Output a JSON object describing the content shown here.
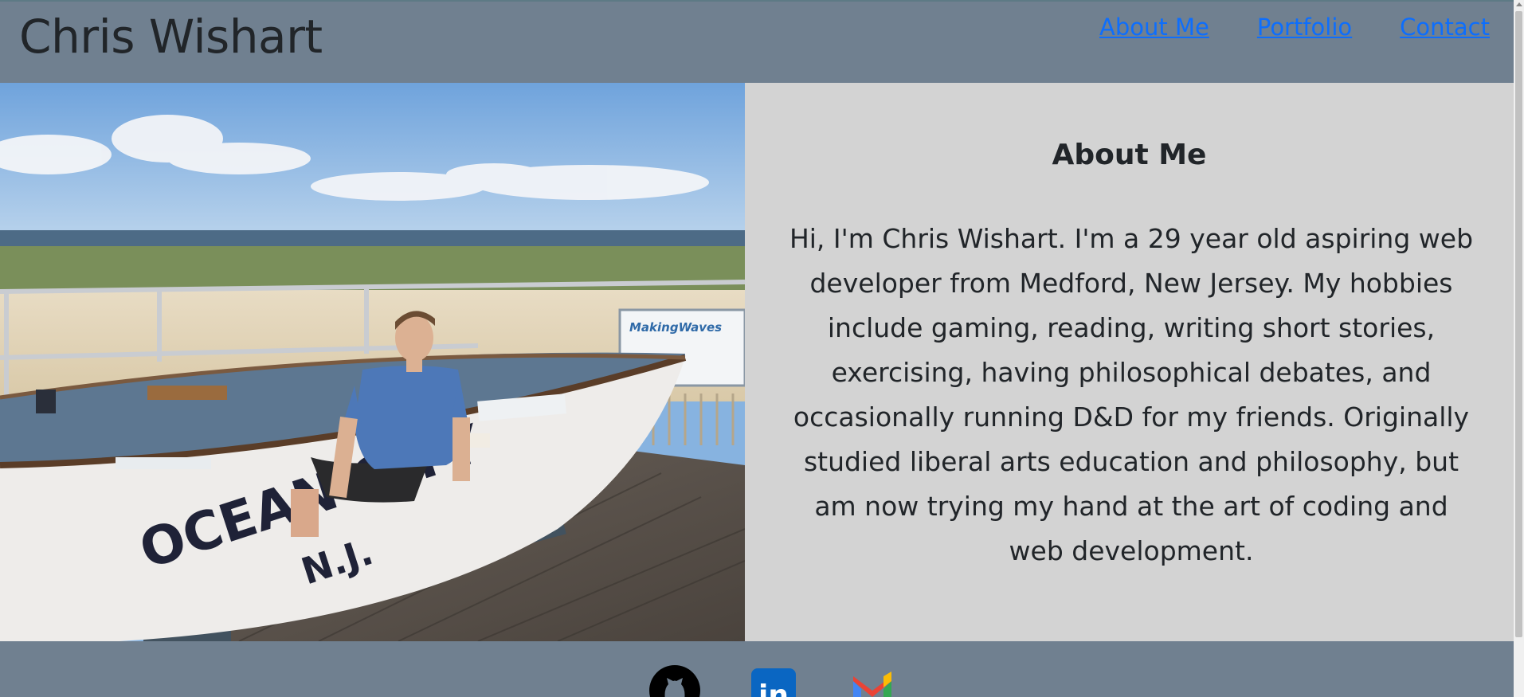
{
  "header": {
    "title": "Chris Wishart",
    "nav": [
      "About Me",
      "Portfolio",
      "Contact"
    ]
  },
  "photo": {
    "boat_text_line1": "OCEAN CITY",
    "boat_text_line2": "N.J.",
    "sign_text": "MakingWaves"
  },
  "about": {
    "heading": "About Me",
    "body": "Hi, I'm Chris Wishart. I'm a 29 year old aspiring web developer from Medford, New Jersey. My hobbies include gaming, reading, writing short stories, exercising, having philosophical debates, and occasionally running D&D for my friends. Originally studied liberal arts education and philosophy, but am now trying my hand at the art of coding and web development."
  },
  "footer": {
    "icons": [
      "github-icon",
      "linkedin-icon",
      "gmail-icon"
    ],
    "linkedin_text": "in"
  },
  "colors": {
    "header_bg": "#708090",
    "about_bg": "#d3d3d3",
    "link": "#0d6efd",
    "text": "#212529"
  }
}
